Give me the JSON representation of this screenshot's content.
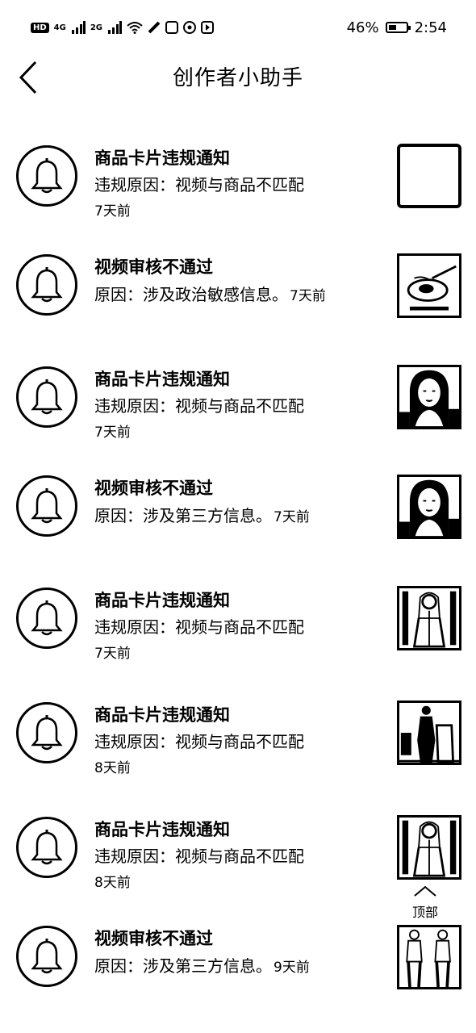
{
  "status_bar": {
    "hd": "HD",
    "network1": "4G",
    "network2": "2G",
    "battery_percent": "46%",
    "battery_level": 0.46,
    "time": "2:54"
  },
  "header": {
    "title": "创作者小助手",
    "back_icon": "chevron-left-icon"
  },
  "notifications": [
    {
      "title": "商品卡片违规通知",
      "reason": "违规原因：视频与商品不匹配",
      "time": "7天前",
      "time_inline": false,
      "thumb": "blank"
    },
    {
      "title": "视频审核不通过",
      "reason": "原因：涉及政治敏感信息。",
      "time": "7天前",
      "time_inline": true,
      "thumb": "food-bowl"
    },
    {
      "title": "商品卡片违规通知",
      "reason": "违规原因：视频与商品不匹配",
      "time": "7天前",
      "time_inline": false,
      "thumb": "woman-portrait"
    },
    {
      "title": "视频审核不通过",
      "reason": "原因：涉及第三方信息。",
      "time": "7天前",
      "time_inline": true,
      "thumb": "woman-portrait"
    },
    {
      "title": "商品卡片违规通知",
      "reason": "违规原因：视频与商品不匹配",
      "time": "7天前",
      "time_inline": false,
      "thumb": "woman-standing"
    },
    {
      "title": "商品卡片违规通知",
      "reason": "违规原因：视频与商品不匹配",
      "time": "8天前",
      "time_inline": false,
      "thumb": "people-street"
    },
    {
      "title": "商品卡片违规通知",
      "reason": "违规原因：视频与商品不匹配",
      "time": "8天前",
      "time_inline": false,
      "thumb": "woman-standing"
    },
    {
      "title": "视频审核不通过",
      "reason": "原因：涉及第三方信息。",
      "time": "9天前",
      "time_inline": true,
      "thumb": "two-women"
    }
  ],
  "scroll_top": {
    "label": "顶部",
    "icon": "chevron-up-icon"
  }
}
